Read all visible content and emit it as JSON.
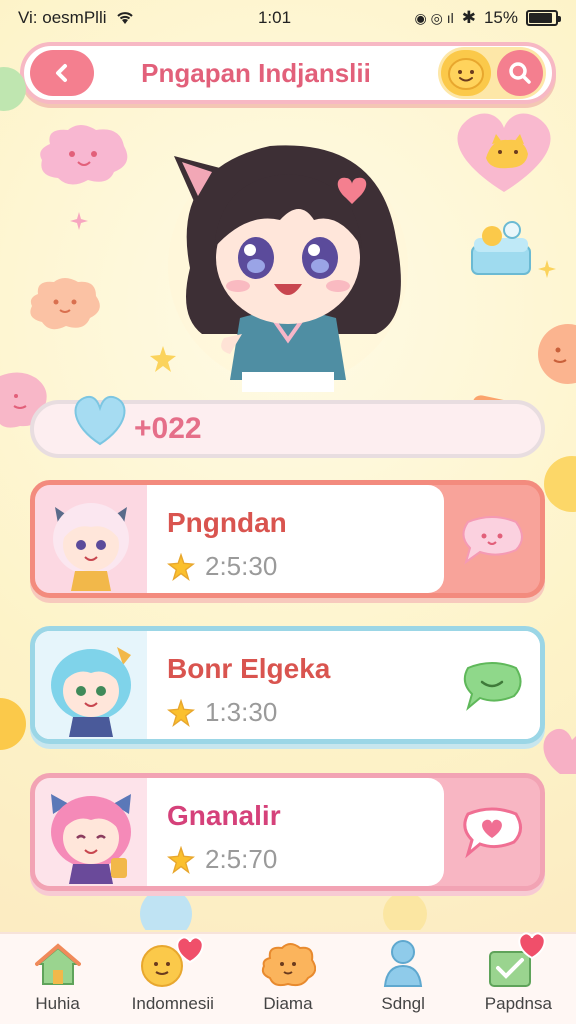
{
  "status_bar": {
    "carrier": "Vi: oesmPlli",
    "time": "1:01",
    "battery": "15%",
    "battery_level": 0.9
  },
  "header": {
    "title": "Pngapan Indjanslii",
    "back_icon": "chevron-left-icon",
    "smile_icon": "smile-face-icon",
    "search_icon": "search-icon"
  },
  "progress": {
    "value": "+022"
  },
  "list": [
    {
      "name": "Pngndan",
      "time": "2:5:30",
      "thumb": "pink-hair-cat-girl",
      "action_icon": "speech-bubble-heart-icon"
    },
    {
      "name": "Bonr Elgeka",
      "time": "1:3:30",
      "thumb": "blue-hair-girl",
      "action_icon": "chat-bubble-icon"
    },
    {
      "name": "Gnanalir",
      "time": "2:5:70",
      "thumb": "pink-hair-bow-girl",
      "action_icon": "heart-bubble-icon"
    }
  ],
  "nav": [
    {
      "label": "Huhia",
      "icon": "house-icon"
    },
    {
      "label": "Indomnesii",
      "icon": "smile-heart-icon"
    },
    {
      "label": "Diama",
      "icon": "cloud-face-icon"
    },
    {
      "label": "Sdngl",
      "icon": "person-icon"
    },
    {
      "label": "Papdnsa",
      "icon": "box-heart-icon"
    }
  ],
  "colors": {
    "accent_pink": "#f47f8f",
    "accent_yellow": "#fbc94a",
    "title_pink": "#e2607a"
  }
}
